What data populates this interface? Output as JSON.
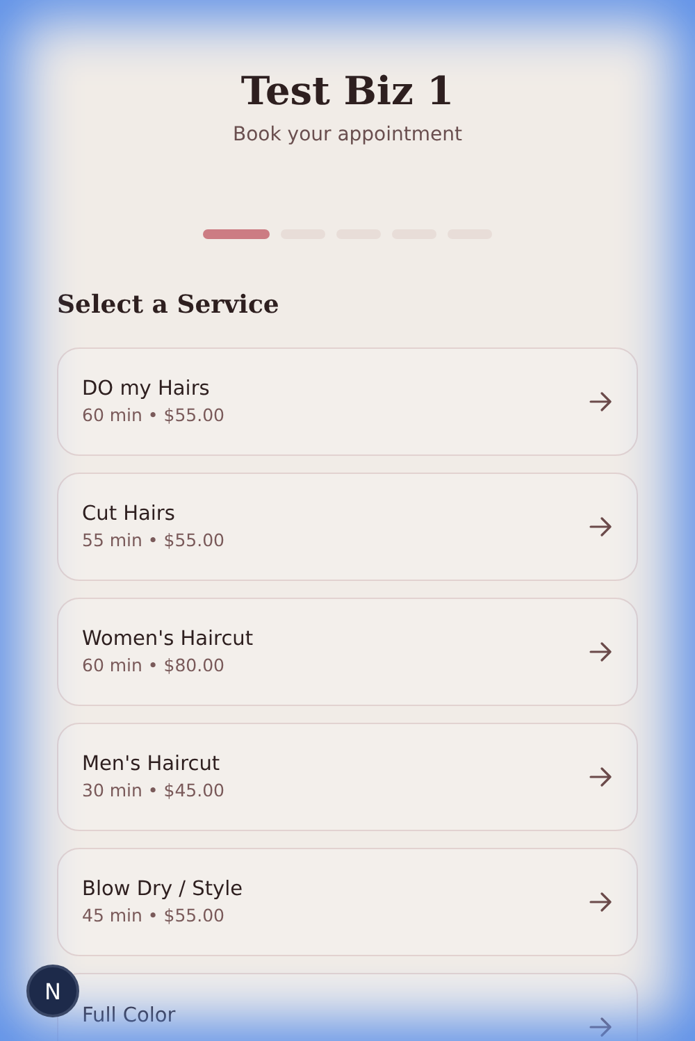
{
  "header": {
    "title": "Test Biz 1",
    "subtitle": "Book your appointment"
  },
  "steps": [
    {
      "selected": true
    },
    {
      "selected": false
    },
    {
      "selected": false
    },
    {
      "selected": false
    },
    {
      "selected": false
    }
  ],
  "section_title": "Select a Service",
  "services": [
    {
      "name": "DO my Hairs",
      "meta": "60 min • $55.00"
    },
    {
      "name": "Cut Hairs",
      "meta": "55 min • $55.00"
    },
    {
      "name": "Women's Haircut",
      "meta": "60 min • $80.00"
    },
    {
      "name": "Men's Haircut",
      "meta": "30 min • $45.00"
    },
    {
      "name": "Blow Dry / Style",
      "meta": "45 min • $55.00"
    },
    {
      "name": "Full Color"
    }
  ],
  "dev_badge": "N"
}
